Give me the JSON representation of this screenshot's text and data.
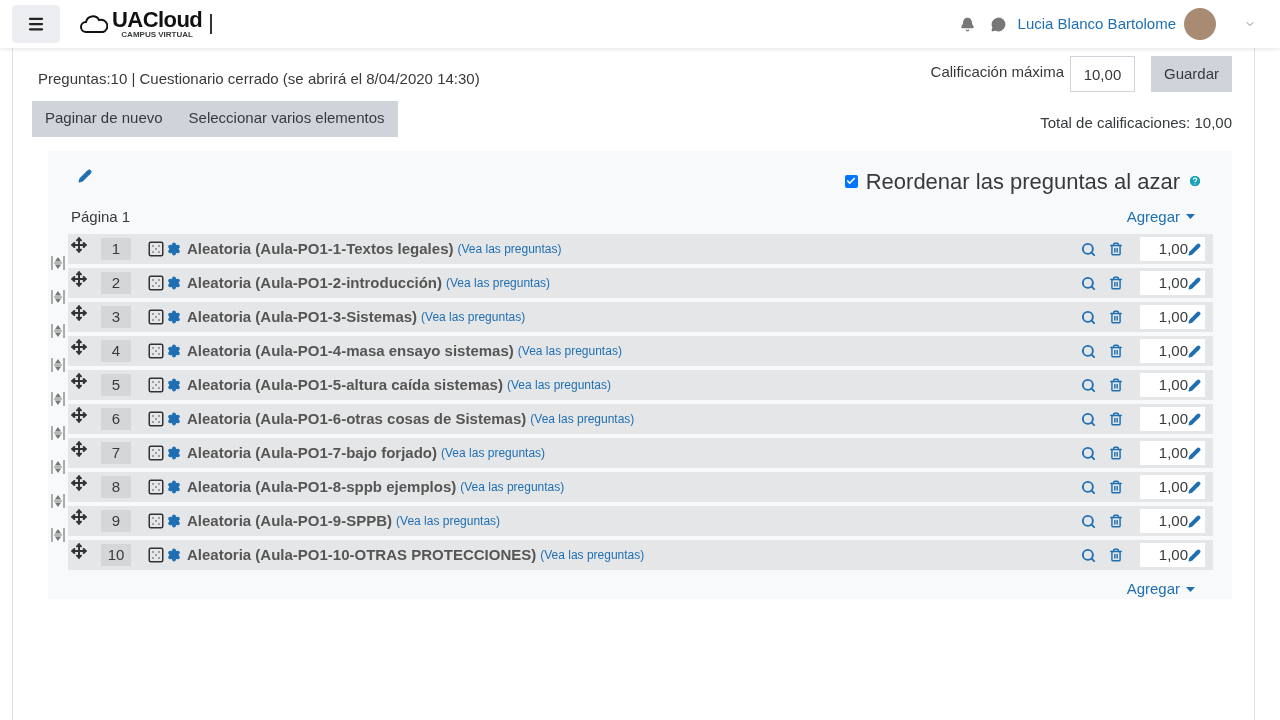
{
  "header": {
    "logo": "UACloud",
    "logo_sub": "CAMPUS VIRTUAL",
    "user_name": "Lucia Blanco Bartolome"
  },
  "info": "Preguntas:10 | Cuestionario cerrado (se abrirá el 8/04/2020 14:30)",
  "max_grade": {
    "label": "Calificación máxima",
    "value": "10,00",
    "button": "Guardar"
  },
  "toolbar": [
    "Paginar de nuevo",
    "Seleccionar varios elementos"
  ],
  "total": "Total de calificaciones: 10,00",
  "shuffle": {
    "label": "Reordenar las preguntas al azar",
    "checked": true
  },
  "page_label": "Página 1",
  "add_label": "Agregar",
  "questions": [
    {
      "number": "1",
      "title": "Aleatoria (Aula-PO1-1-Textos legales)",
      "link": "(Vea las preguntas)",
      "mark": "1,00"
    },
    {
      "number": "2",
      "title": "Aleatoria (Aula-PO1-2-introducción)",
      "link": "(Vea las preguntas)",
      "mark": "1,00"
    },
    {
      "number": "3",
      "title": "Aleatoria (Aula-PO1-3-Sistemas)",
      "link": "(Vea las preguntas)",
      "mark": "1,00"
    },
    {
      "number": "4",
      "title": "Aleatoria (Aula-PO1-4-masa ensayo sistemas)",
      "link": "(Vea las preguntas)",
      "mark": "1,00"
    },
    {
      "number": "5",
      "title": "Aleatoria (Aula-PO1-5-altura caída sistemas)",
      "link": "(Vea las preguntas)",
      "mark": "1,00"
    },
    {
      "number": "6",
      "title": "Aleatoria (Aula-PO1-6-otras cosas de Sistemas)",
      "link": "(Vea las preguntas)",
      "mark": "1,00"
    },
    {
      "number": "7",
      "title": "Aleatoria (Aula-PO1-7-bajo forjado)",
      "link": "(Vea las preguntas)",
      "mark": "1,00"
    },
    {
      "number": "8",
      "title": "Aleatoria (Aula-PO1-8-sppb ejemplos)",
      "link": "(Vea las preguntas)",
      "mark": "1,00"
    },
    {
      "number": "9",
      "title": "Aleatoria (Aula-PO1-9-SPPB)",
      "link": "(Vea las preguntas)",
      "mark": "1,00"
    },
    {
      "number": "10",
      "title": "Aleatoria (Aula-PO1-10-OTRAS PROTECCIONES)",
      "link": "(Vea las preguntas)",
      "mark": "1,00"
    }
  ],
  "footer_add_label": "Agregar"
}
